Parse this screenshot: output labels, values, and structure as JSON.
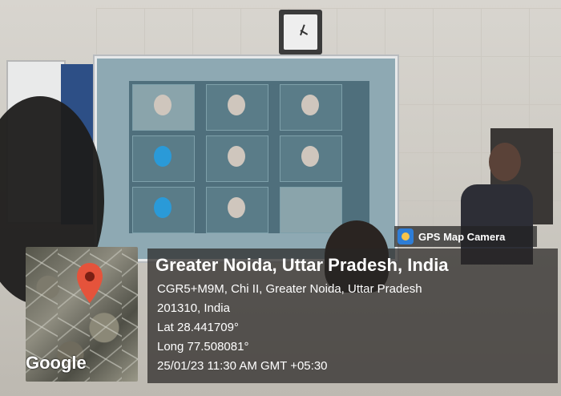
{
  "overlay": {
    "app_badge": "GPS Map Camera",
    "location_title": "Greater Noida, Uttar Pradesh, India",
    "address_line1": "CGR5+M9M, Chi II, Greater Noida, Uttar Pradesh",
    "address_line2": "201310, India",
    "lat": "Lat 28.441709°",
    "long": "Long 77.508081°",
    "datetime": "25/01/23 11:30 AM GMT +05:30",
    "map_provider": "Google"
  },
  "colors": {
    "pin_red": "#e5533b",
    "badge_blue": "#2e7dd6",
    "overlay_bg": "rgba(40,38,36,0.72)"
  },
  "icons": {
    "map_pin": "location-pin-icon",
    "camera_app": "gps-map-camera-icon"
  }
}
